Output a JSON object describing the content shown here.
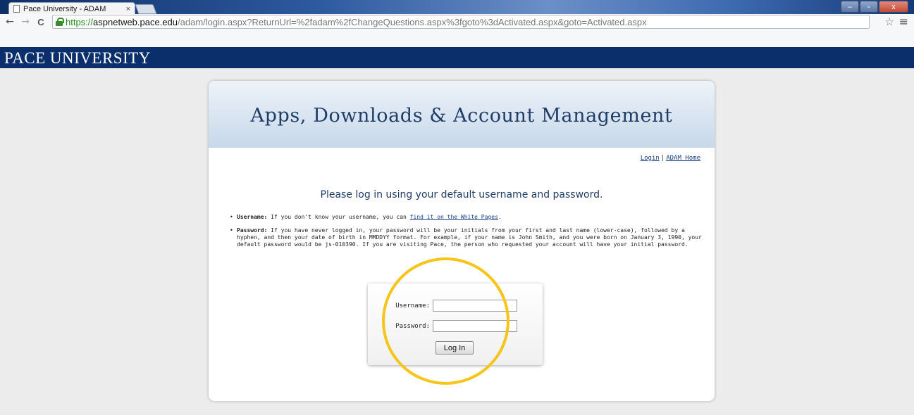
{
  "browser": {
    "tab_title": "Pace University - ADAM",
    "tab_close": "×",
    "url_scheme": "https://",
    "url_host": "aspnetweb.pace.edu",
    "url_path": "/adam/login.aspx?ReturnUrl=%2fadam%2fChangeQuestions.aspx%3fgoto%3dActivated.aspx&goto=Activated.aspx",
    "back": "←",
    "forward": "→",
    "reload": "C",
    "star": "☆",
    "menu": "≡",
    "window_buttons": {
      "minimize": "–",
      "maximize": "▫",
      "close": "x"
    }
  },
  "banner": {
    "title": "PACE UNIVERSITY"
  },
  "card": {
    "title": "Apps, Downloads & Account Management",
    "links": {
      "login": "Login",
      "separator": "|",
      "home": "ADAM Home"
    },
    "prompt": "Please log in using your default username and password.",
    "username_info": {
      "label": "Username:",
      "text": " If you don't know your username, you can ",
      "link": "find it on the White Pages",
      "tail": "."
    },
    "password_info": {
      "label": "Password:",
      "text": " If you have never logged in, your password will be your initials from your first and last name (lower-case), followed by a hyphen, and then your date of birth in MMDDYY format. For example, if your name is John Smith, and you were born on January 3, 1990, your default password would be js-010390. If you are visiting Pace, the person who requested your account will have your initial password."
    }
  },
  "login_form": {
    "username_label": "Username:",
    "username_value": "",
    "password_label": "Password:",
    "password_value": "",
    "submit_label": "Log In"
  },
  "annotation": {
    "ring_color": "#f6c51c"
  }
}
